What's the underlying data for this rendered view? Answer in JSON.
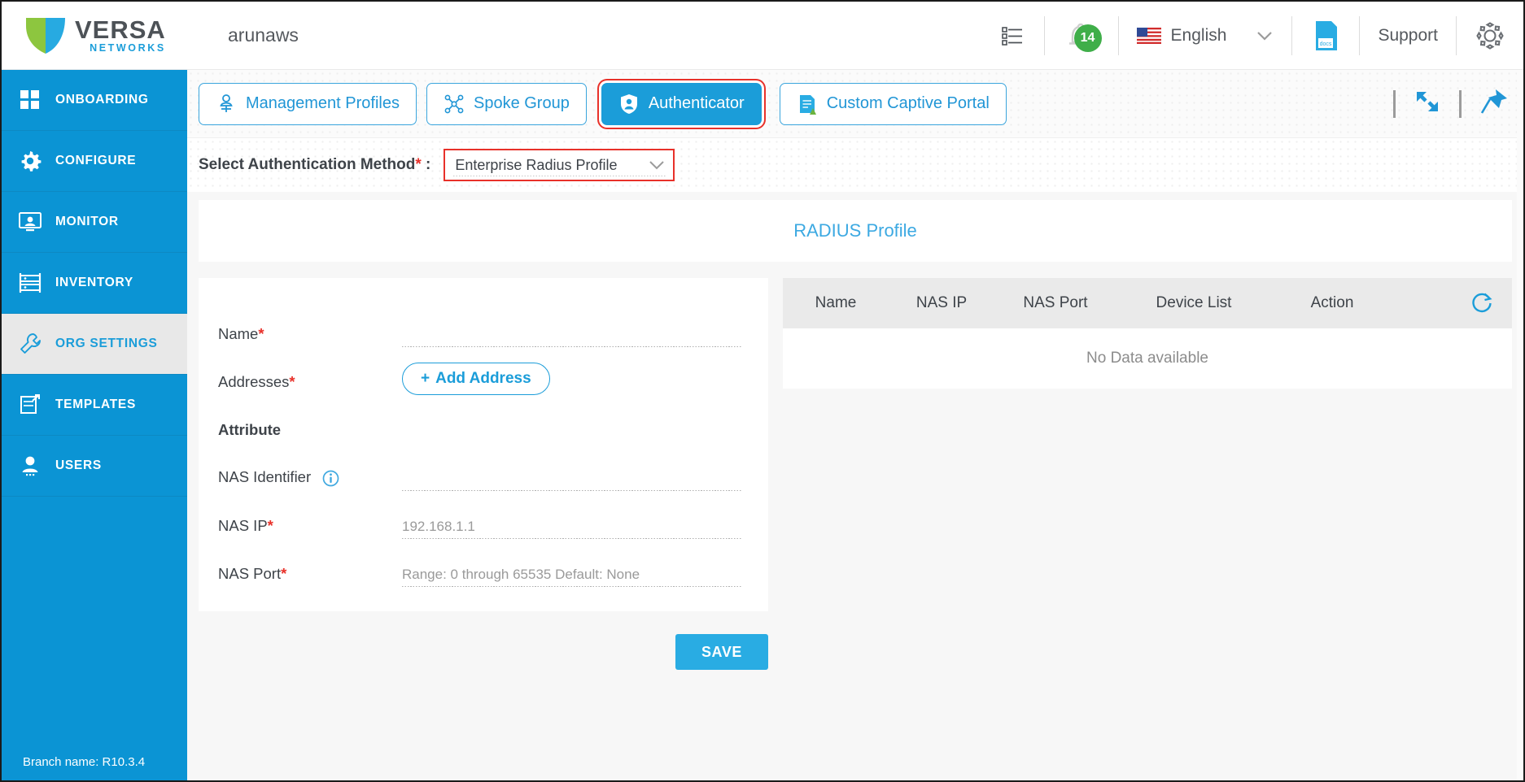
{
  "header": {
    "logo_word": "VERSA",
    "logo_sub": "NETWORKS",
    "tenant": "arunaws",
    "list_icon": "list-icon",
    "notifications_count": "14",
    "language": "English",
    "docs_label": "docs",
    "support": "Support",
    "settings_icon": "gear-icon"
  },
  "sidebar": {
    "items": [
      {
        "label": "ONBOARDING",
        "icon": "grid-icon",
        "active": false
      },
      {
        "label": "CONFIGURE",
        "icon": "gear-icon",
        "active": false
      },
      {
        "label": "MONITOR",
        "icon": "monitor-icon",
        "active": false
      },
      {
        "label": "INVENTORY",
        "icon": "rack-icon",
        "active": false
      },
      {
        "label": "ORG SETTINGS",
        "icon": "wrench-icon",
        "active": true
      },
      {
        "label": "TEMPLATES",
        "icon": "template-icon",
        "active": false
      },
      {
        "label": "USERS",
        "icon": "user-icon",
        "active": false
      }
    ],
    "branch": "Branch name: R10.3.4"
  },
  "tabs": [
    {
      "label": "Management Profiles",
      "icon": "user-profile-icon",
      "active": false
    },
    {
      "label": "Spoke Group",
      "icon": "network-nodes-icon",
      "active": false
    },
    {
      "label": "Authenticator",
      "icon": "shield-user-icon",
      "active": true
    },
    {
      "label": "Custom Captive Portal",
      "icon": "document-icon",
      "active": false
    }
  ],
  "tab_actions": {
    "expand_icon": "expand-collapse-icon",
    "pin_icon": "pin-icon"
  },
  "auth_method": {
    "label": "Select Authentication Method",
    "required_mark": "*",
    "colon": " :",
    "selected": "Enterprise Radius Profile",
    "options": [
      "Enterprise Radius Profile"
    ]
  },
  "profile": {
    "title": "RADIUS Profile",
    "fields": {
      "name_label": "Name",
      "name_value": "",
      "addresses_label": "Addresses",
      "add_address_button": "Add Address",
      "add_address_plus": "+",
      "attribute_label": "Attribute",
      "nas_identifier_label": "NAS Identifier",
      "nas_identifier_value": "",
      "nas_identifier_info_icon": "info-icon",
      "nas_ip_label": "NAS IP",
      "nas_ip_placeholder": "192.168.1.1",
      "nas_port_label": "NAS Port",
      "nas_port_placeholder": "Range: 0 through 65535 Default: None"
    },
    "save_button": "SAVE"
  },
  "table": {
    "columns": [
      "Name",
      "NAS IP",
      "NAS Port",
      "Device List",
      "Action"
    ],
    "refresh_icon": "refresh-icon",
    "empty_message": "No Data available",
    "rows": []
  },
  "colors": {
    "brand_blue": "#0b94d4",
    "accent_blue": "#1b9dd9",
    "highlight_red": "#e8312a",
    "badge_green": "#3fae49",
    "save_blue": "#29ace3"
  }
}
